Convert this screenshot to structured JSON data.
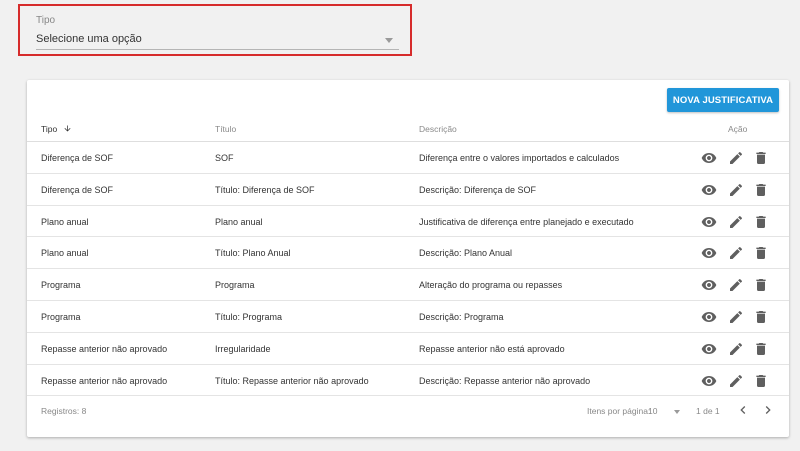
{
  "filter": {
    "label": "Tipo",
    "selected": "Selecione uma opção"
  },
  "toolbar": {
    "new_label": "NOVA JUSTIFICATIVA"
  },
  "table": {
    "headers": {
      "tipo": "Tipo",
      "titulo": "Título",
      "descricao": "Descrição",
      "acao": "Ação"
    },
    "sort": {
      "column": "tipo",
      "direction": "descending"
    },
    "rows": [
      {
        "tipo": "Diferença de SOF",
        "titulo": "SOF",
        "descricao": "Diferença entre o valores importados e calculados"
      },
      {
        "tipo": "Diferença de SOF",
        "titulo": "Título: Diferença de SOF",
        "descricao": "Descrição: Diferença de SOF"
      },
      {
        "tipo": "Plano anual",
        "titulo": "Plano anual",
        "descricao": "Justificativa de diferença entre planejado e executado"
      },
      {
        "tipo": "Plano anual",
        "titulo": "Título: Plano Anual",
        "descricao": "Descrição: Plano Anual"
      },
      {
        "tipo": "Programa",
        "titulo": "Programa",
        "descricao": "Alteração do programa ou repasses"
      },
      {
        "tipo": "Programa",
        "titulo": "Título: Programa",
        "descricao": "Descrição: Programa"
      },
      {
        "tipo": "Repasse anterior não aprovado",
        "titulo": "Irregularidade",
        "descricao": "Repasse anterior não está aprovado"
      },
      {
        "tipo": "Repasse anterior não aprovado",
        "titulo": "Título: Repasse anterior não aprovado",
        "descricao": "Descrição: Repasse anterior não aprovado"
      }
    ],
    "row_actions": [
      "eye-icon",
      "pencil-icon",
      "trash-icon"
    ]
  },
  "footer": {
    "registros": "Registros: 8",
    "per_page_label": "Itens por página:",
    "per_page_value": "10",
    "range": "1 de 1"
  },
  "colors": {
    "accent": "#2196d9",
    "highlight_border": "#d62b2b",
    "icon": "#5f5f5f"
  }
}
